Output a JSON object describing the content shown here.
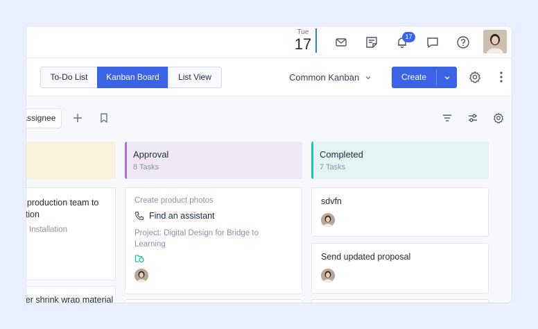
{
  "header": {
    "date": {
      "weekday": "Tue",
      "day": "17"
    },
    "notification_count": "17",
    "icons": [
      "mail-icon",
      "notes-icon",
      "bell-icon",
      "chat-icon",
      "help-icon"
    ]
  },
  "viewbar": {
    "tabs": [
      {
        "label": "To-Do List",
        "active": false
      },
      {
        "label": "Kanban Board",
        "active": true
      },
      {
        "label": "List View",
        "active": false
      }
    ],
    "board_select": "Common Kanban",
    "create_label": "Create"
  },
  "filters": {
    "assignee_label": "Assignee"
  },
  "columns": [
    {
      "title": "",
      "count": "",
      "color": "#faf1dc",
      "cards": [
        {
          "title": "Assign the production team to the installation",
          "subtitle": "Installation"
        },
        {
          "title": "Order shrink wrap material"
        }
      ]
    },
    {
      "title": "Approval",
      "count": "8 Tasks",
      "color": "#efe8f8",
      "accent": "#a970d6",
      "cards": [
        {
          "parent": "Create product photos",
          "title": "Find an assistant",
          "project": "Project: Digital Design for Bridge to Learning"
        }
      ]
    },
    {
      "title": "Completed",
      "count": "7 Tasks",
      "color": "#e2f4f3",
      "accent": "#1cc3b2",
      "cards": [
        {
          "title": "sdvfn"
        },
        {
          "title": "Send updated proposal"
        }
      ]
    }
  ]
}
